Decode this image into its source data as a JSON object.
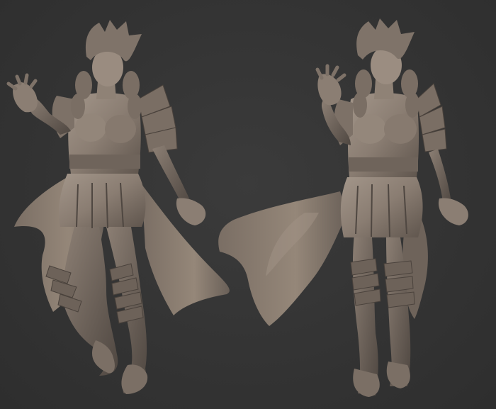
{
  "scene": {
    "background_color": "#353535",
    "clay_color": "#8a7d72",
    "clay_shadow": "#5e544c",
    "clay_highlight": "#a89a8d"
  },
  "figures": [
    {
      "name": "armored-female-sculpt-front-left-view"
    },
    {
      "name": "armored-female-sculpt-front-right-view"
    }
  ]
}
